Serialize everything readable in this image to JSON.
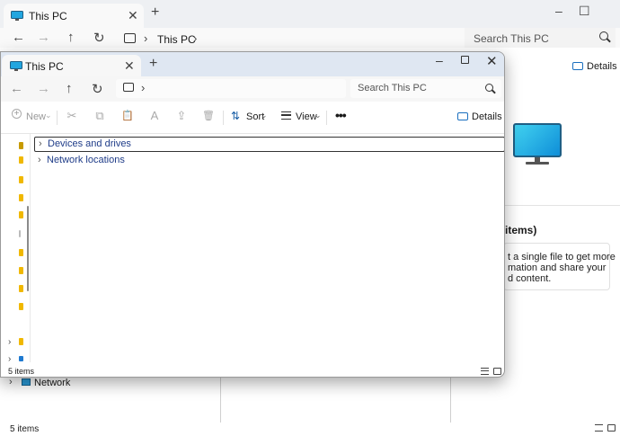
{
  "back_window": {
    "tab_title": "This PC",
    "close_glyph": "✕",
    "new_tab_glyph": "+",
    "minimize_glyph": "–",
    "maximize_glyph": "☐",
    "nav": {
      "back": "←",
      "forward": "→",
      "up": "↑",
      "refresh": "↻"
    },
    "breadcrumb": "This PC",
    "chevron": "›",
    "search_placeholder": "Search This PC",
    "details_label": "Details",
    "details_items_heading": "items)",
    "details_info_lines": [
      "t a single file to get more",
      "mation and share your",
      "d content."
    ],
    "nav_network_label": "Network",
    "nav_expand": "›",
    "status_text": "5 items"
  },
  "front_window": {
    "tab_title": "This PC",
    "close_glyph": "✕",
    "new_tab_glyph": "+",
    "minimize_glyph": "–",
    "close_window_glyph": "✕",
    "nav": {
      "back": "←",
      "forward": "→",
      "up": "↑",
      "refresh": "↻"
    },
    "chevron": "›",
    "search_placeholder": "Search This PC",
    "toolbar": {
      "new_label": "New",
      "sort_label": "Sort",
      "view_label": "View",
      "more_glyph": "•••",
      "details_label": "Details",
      "dropdown_glyph": "⌄",
      "plus_glyph": "+",
      "sort_glyph": "⇅",
      "cut_glyph": "✂",
      "copy_glyph": "⧉",
      "paste_glyph": "📋",
      "rename_glyph": "A",
      "share_glyph": "⇪",
      "delete_glyph": "🗑"
    },
    "groups": [
      {
        "label": "Devices and drives",
        "expand": "›",
        "selected": true
      },
      {
        "label": "Network locations",
        "expand": "›",
        "selected": false
      }
    ],
    "nav_expand": "›",
    "status_text": "5 items"
  },
  "colors": {
    "accent": "#1a6fbf",
    "link_text": "#1f3c88",
    "folder_yellow": "#f0b800",
    "title_bar_active": "#dfe7f2",
    "title_bar_inactive": "#eef0f3"
  }
}
